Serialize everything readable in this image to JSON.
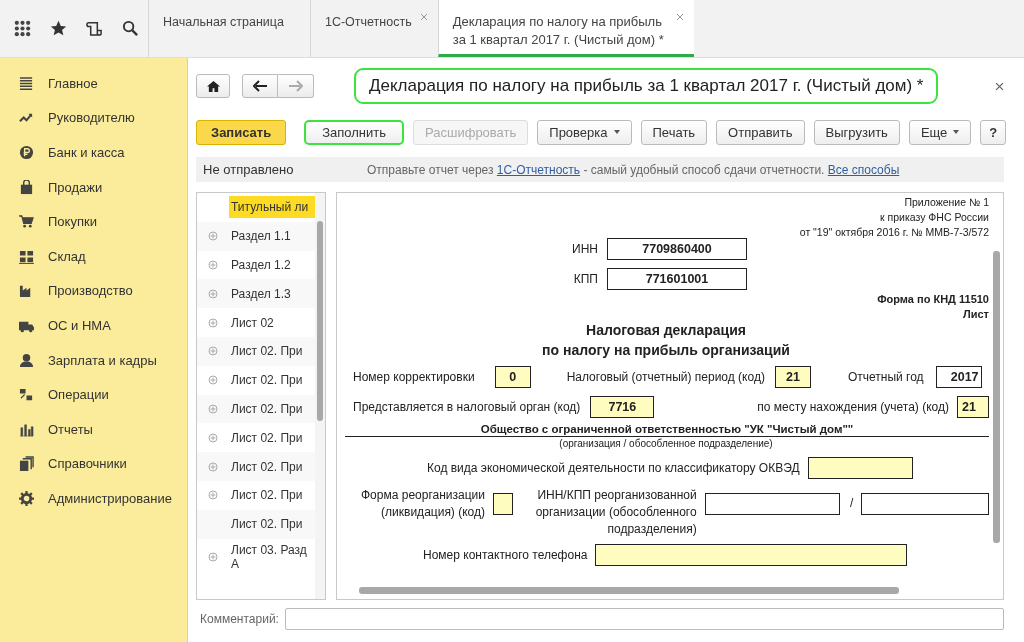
{
  "tabs": [
    {
      "label": "Начальная страница",
      "selected": false,
      "closable": false
    },
    {
      "label": "1С-Отчетность",
      "selected": false,
      "closable": true
    },
    {
      "label": "Декларация по налогу на прибыль за 1 квартал 2017 г. (Чистый дом) *",
      "selected": true,
      "closable": true
    }
  ],
  "sidebar": {
    "items": [
      {
        "label": "Главное"
      },
      {
        "label": "Руководителю"
      },
      {
        "label": "Банк и касса"
      },
      {
        "label": "Продажи"
      },
      {
        "label": "Покупки"
      },
      {
        "label": "Склад"
      },
      {
        "label": "Производство"
      },
      {
        "label": "ОС и НМА"
      },
      {
        "label": "Зарплата и кадры"
      },
      {
        "label": "Операции"
      },
      {
        "label": "Отчеты"
      },
      {
        "label": "Справочники"
      },
      {
        "label": "Администрирование"
      }
    ]
  },
  "form": {
    "title": "Декларация по налогу на прибыль за 1 квартал 2017 г. (Чистый дом) *",
    "title_highlighted": true
  },
  "buttons": [
    {
      "label": "Записать",
      "kind": "primary",
      "disabled": false,
      "highlighted": false
    },
    {
      "label": "Заполнить",
      "kind": "normal",
      "disabled": false,
      "highlighted": true
    },
    {
      "label": "Расшифровать",
      "kind": "normal",
      "disabled": true,
      "highlighted": false
    },
    {
      "label": "Проверка",
      "kind": "menu",
      "disabled": false,
      "highlighted": false
    },
    {
      "label": "Печать",
      "kind": "normal",
      "disabled": false,
      "highlighted": false
    },
    {
      "label": "Отправить",
      "kind": "normal",
      "disabled": false,
      "highlighted": false
    },
    {
      "label": "Выгрузить",
      "kind": "normal",
      "disabled": false,
      "highlighted": false
    },
    {
      "label": "Еще",
      "kind": "menu",
      "disabled": false,
      "highlighted": false
    },
    {
      "label": "?",
      "kind": "help",
      "disabled": false,
      "highlighted": false
    }
  ],
  "status": {
    "state": "Не отправлено",
    "message": [
      {
        "kind": "text",
        "text": "Отправьте отчет через "
      },
      {
        "kind": "link",
        "text": "1С-Отчетность"
      },
      {
        "kind": "text",
        "text": " - самый удобный способ сдачи отчетности. "
      },
      {
        "kind": "link",
        "text": "Все способы"
      }
    ]
  },
  "sections": [
    {
      "label": "Титульный ли",
      "selected": true,
      "expandable": false
    },
    {
      "label": "Раздел 1.1",
      "selected": false,
      "expandable": true
    },
    {
      "label": "Раздел 1.2",
      "selected": false,
      "expandable": true
    },
    {
      "label": "Раздел 1.3",
      "selected": false,
      "expandable": true
    },
    {
      "label": "Лист 02",
      "selected": false,
      "expandable": true
    },
    {
      "label": "Лист 02. При",
      "selected": false,
      "expandable": true
    },
    {
      "label": "Лист 02. При",
      "selected": false,
      "expandable": true
    },
    {
      "label": "Лист 02. При",
      "selected": false,
      "expandable": true
    },
    {
      "label": "Лист 02. При",
      "selected": false,
      "expandable": true
    },
    {
      "label": "Лист 02. При",
      "selected": false,
      "expandable": true
    },
    {
      "label": "Лист 02. При",
      "selected": false,
      "expandable": true
    },
    {
      "label": "Лист 02. При",
      "selected": false,
      "expandable": false
    },
    {
      "label": "Лист 03. Разд А",
      "selected": false,
      "expandable": true
    }
  ],
  "document": {
    "appendix_note": [
      "Приложение № 1",
      "к приказу ФНС России",
      "от \"19\" октября 2016 г. № ММВ-7-3/572"
    ],
    "inn": {
      "label": "ИНН",
      "value": "7709860400",
      "editable": false
    },
    "kpp": {
      "label": "КПП",
      "value": "771601001",
      "editable": false
    },
    "form_code": [
      "Форма по КНД 11510",
      "Лист"
    ],
    "title": [
      "Налоговая декларация",
      "по налогу на прибыль организаций"
    ],
    "correction": {
      "label": "Номер корректировки",
      "value": "0",
      "editable": true
    },
    "period": {
      "label": "Налоговый (отчетный) период (код)",
      "value": "21",
      "editable": true
    },
    "year": {
      "label": "Отчетный год",
      "value": "2017",
      "editable": false
    },
    "tax_authority": {
      "label": "Представляется в налоговый орган (код)",
      "value": "7716",
      "editable": true
    },
    "location": {
      "label": "по месту нахождения (учета) (код)",
      "value": "21",
      "editable": true
    },
    "organization": "Общество с ограниченной ответственностью \"УК \"Чистый дом\"\"",
    "organization_caption": "(организация / обособленное подразделение)",
    "okved": {
      "label": "Код вида экономической деятельности по классификатору ОКВЭД",
      "editable": true
    },
    "reorganization_form": {
      "label": "Форма реорганизации (ликвидация) (код)",
      "editable": true
    },
    "reorganized_inn_kpp": {
      "label": "ИНН/КПП реорганизованной организации (обособленного подразделения)",
      "separator": "/",
      "editable": false
    },
    "phone": {
      "label": "Номер контактного телефона",
      "editable": true
    }
  },
  "comment": {
    "label": "Комментарий:"
  }
}
